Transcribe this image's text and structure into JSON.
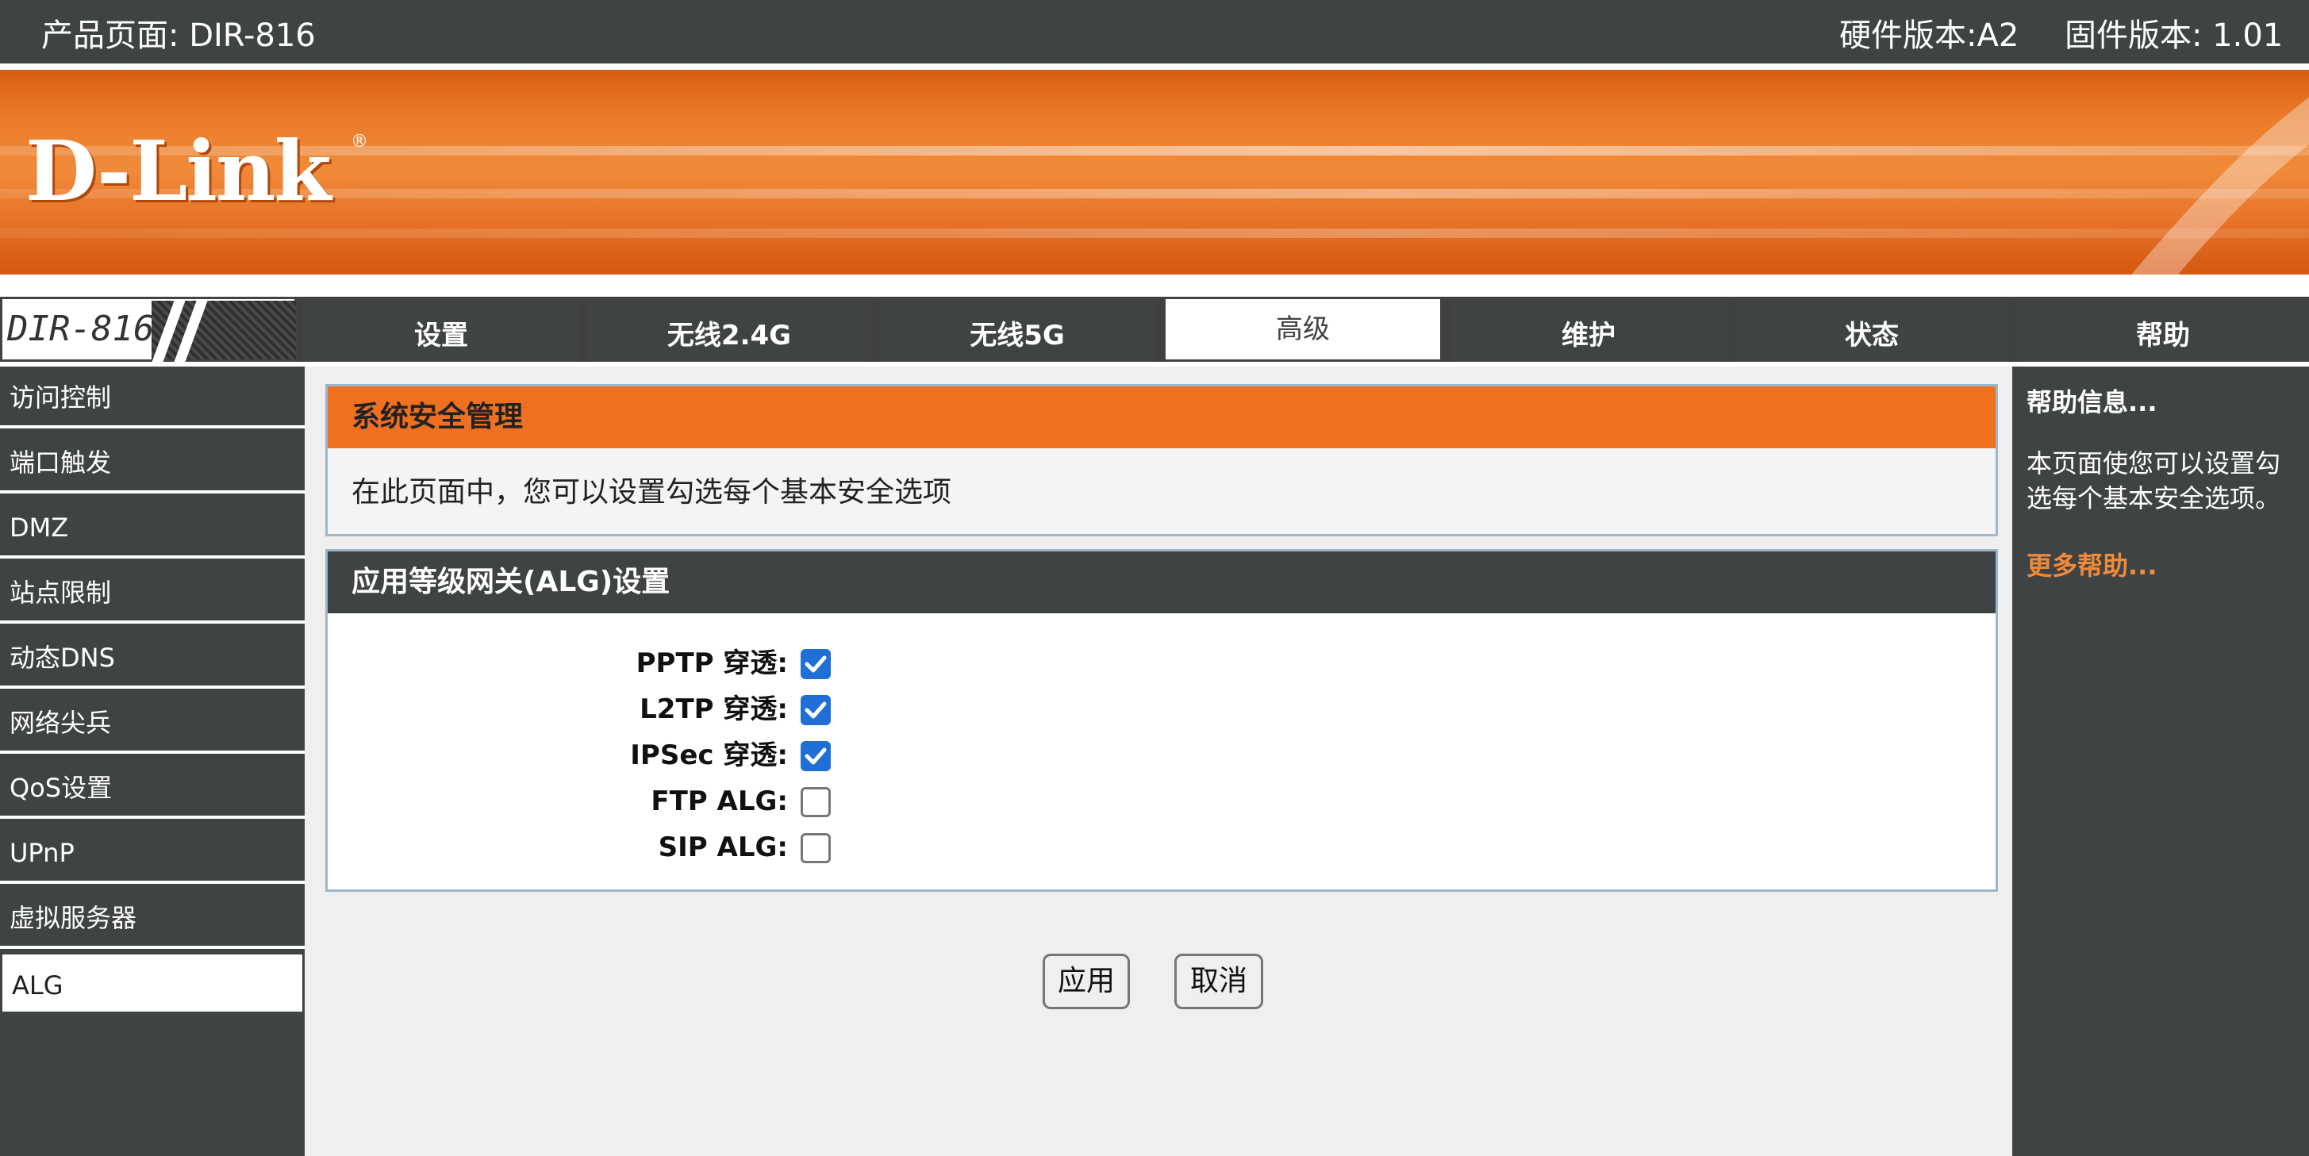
{
  "topbar": {
    "product": "产品页面: DIR-816",
    "hardware": "硬件版本:A2",
    "firmware": "固件版本: 1.01"
  },
  "banner": {
    "logo": "D-Link",
    "registered": "®"
  },
  "model_box": {
    "model": "DIR-816"
  },
  "tabs": [
    {
      "label": "设置"
    },
    {
      "label": "无线2.4G"
    },
    {
      "label": "无线5G"
    },
    {
      "label": "高级"
    },
    {
      "label": "维护"
    },
    {
      "label": "状态"
    },
    {
      "label": "帮助"
    }
  ],
  "active_tab": "高级",
  "sidebar": {
    "items": [
      {
        "label": "访问控制"
      },
      {
        "label": "端口触发"
      },
      {
        "label": "DMZ"
      },
      {
        "label": "站点限制"
      },
      {
        "label": "动态DNS"
      },
      {
        "label": "网络尖兵"
      },
      {
        "label": "QoS设置"
      },
      {
        "label": "UPnP"
      },
      {
        "label": "虚拟服务器"
      },
      {
        "label": "ALG"
      }
    ],
    "active": "ALG"
  },
  "security_section": {
    "title": "系统安全管理",
    "description": "在此页面中，您可以设置勾选每个基本安全选项"
  },
  "alg_section": {
    "title": "应用等级网关(ALG)设置",
    "options": [
      {
        "label": "PPTP 穿透:",
        "checked": true
      },
      {
        "label": "L2TP 穿透:",
        "checked": true
      },
      {
        "label": "IPSec 穿透:",
        "checked": true
      },
      {
        "label": "FTP ALG:",
        "checked": false
      },
      {
        "label": "SIP ALG:",
        "checked": false
      }
    ]
  },
  "buttons": {
    "apply": "应用",
    "cancel": "取消"
  },
  "help": {
    "title": "帮助信息...",
    "text": "本页面使您可以设置勾选每个基本安全选项。",
    "more": "更多帮助..."
  },
  "colors": {
    "dark": "#404344",
    "orange": "#f07022",
    "link_orange": "#f08b3a",
    "checkbox_blue": "#1f6fd6"
  }
}
